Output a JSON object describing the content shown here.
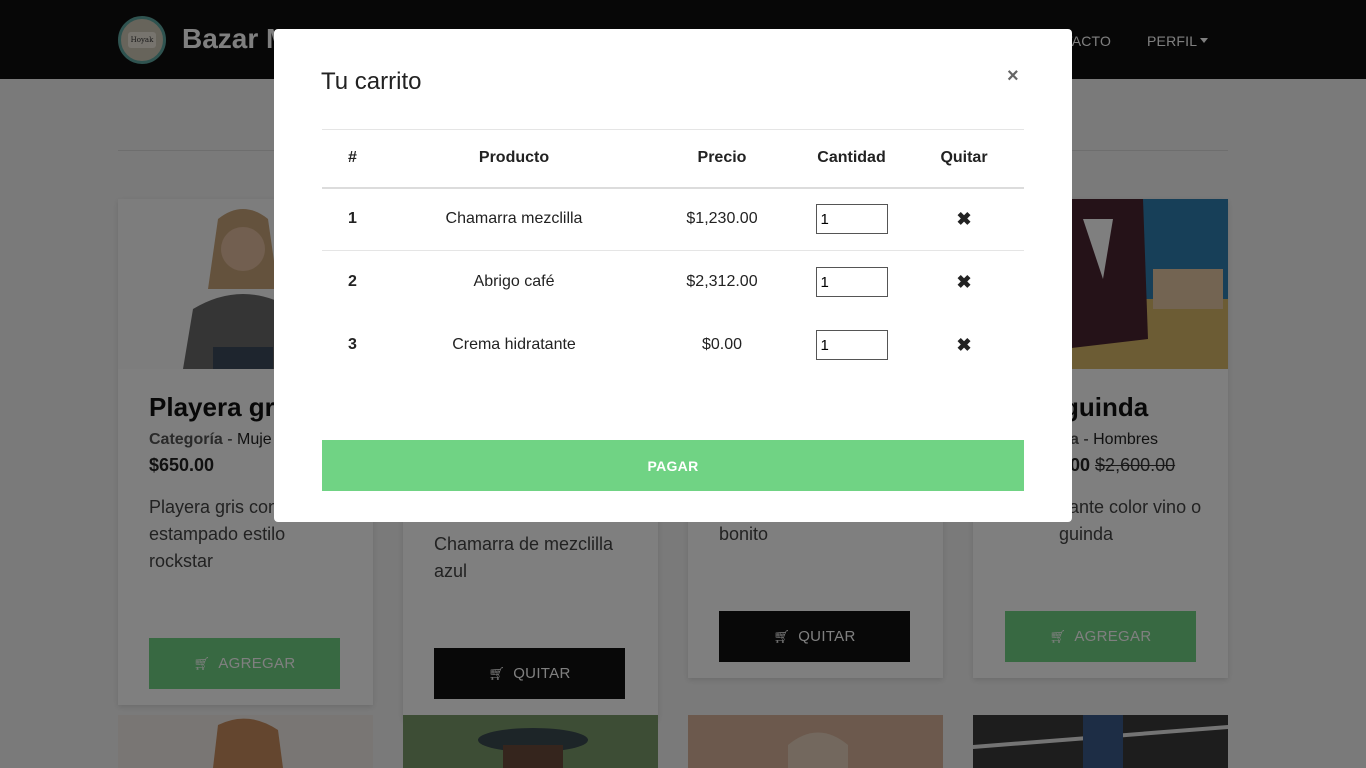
{
  "navbar": {
    "brand": "Bazar M",
    "logo_text": "Hoyak",
    "contacto_label": "TACTO",
    "perfil_label": "PERFIL"
  },
  "products": [
    {
      "title": "Playera gr",
      "category_label": "Categoría",
      "category_value": " - Muje",
      "price": "$650.00",
      "description": "Playera gris con estampado estilo rockstar",
      "button": "AGREGAR"
    },
    {
      "description": "Chamarra de mezclilla azul",
      "button": "QUITAR"
    },
    {
      "description": "bonito",
      "button": "QUITAR"
    },
    {
      "title": "guinda",
      "category_label": "a",
      "category_value": " - Hombres",
      "price": "00",
      "old_price": "$2,600.00",
      "description": "gante color vino o guinda",
      "button": "AGREGAR"
    }
  ],
  "cart_modal": {
    "title": "Tu carrito",
    "close_symbol": "×",
    "columns": [
      "#",
      "Producto",
      "Precio",
      "Cantidad",
      "Quitar"
    ],
    "rows": [
      {
        "index": "1",
        "product": "Chamarra mezclilla",
        "price": "$1,230.00",
        "quantity": "1"
      },
      {
        "index": "2",
        "product": "Abrigo café",
        "price": "$2,312.00",
        "quantity": "1"
      },
      {
        "index": "3",
        "product": "Crema hidratante",
        "price": "$0.00",
        "quantity": "1"
      }
    ],
    "remove_symbol": "✖",
    "pay_label": "PAGAR"
  },
  "colors": {
    "navbar": "#0f0f0f",
    "accent_green": "#70d384",
    "button_black": "#111111"
  },
  "icons": {
    "cart": "shopping-cart-icon",
    "remove": "remove-icon",
    "close": "close-icon"
  }
}
